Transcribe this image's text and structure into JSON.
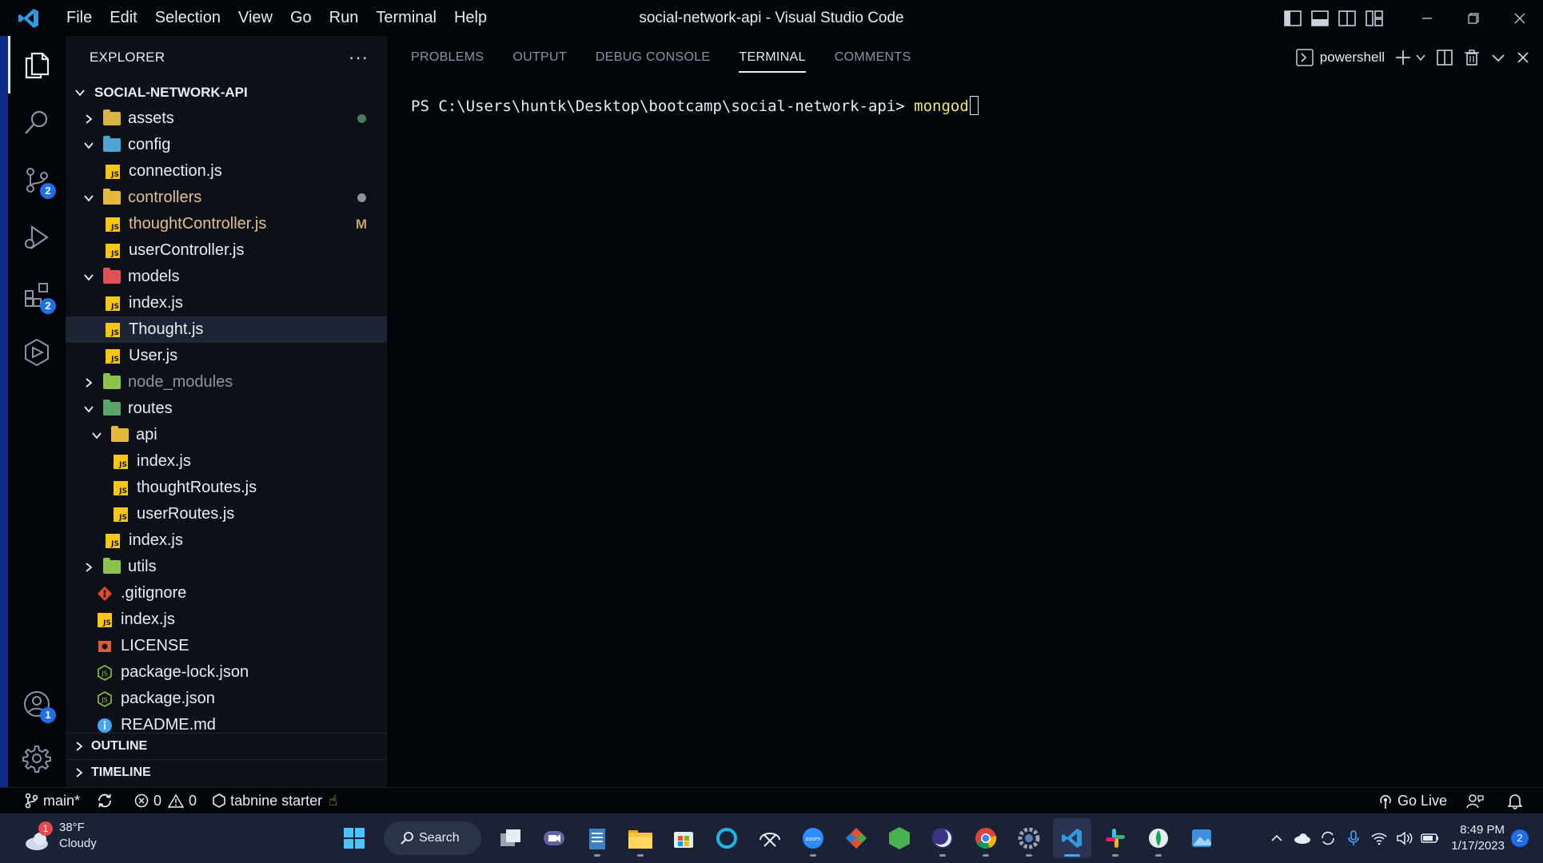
{
  "titlebar": {
    "menu": [
      "File",
      "Edit",
      "Selection",
      "View",
      "Go",
      "Run",
      "Terminal",
      "Help"
    ],
    "title": "social-network-api - Visual Studio Code"
  },
  "activity_bar": {
    "source_control_badge": "2",
    "extensions_badge": "2",
    "accounts_badge": "1"
  },
  "sidebar": {
    "title": "EXPLORER",
    "more": "···",
    "project": "SOCIAL-NETWORK-API",
    "outline": "OUTLINE",
    "timeline": "TIMELINE",
    "tree": [
      {
        "label": "assets",
        "type": "folder",
        "depth": 0,
        "open": false,
        "status": "dot-green",
        "color": "#d9b341"
      },
      {
        "label": "config",
        "type": "folder",
        "depth": 0,
        "open": true,
        "color": "#4fa3d1"
      },
      {
        "label": "connection.js",
        "type": "js",
        "depth": 1
      },
      {
        "label": "controllers",
        "type": "folder",
        "depth": 0,
        "open": true,
        "status": "dot",
        "color": "#e8b93a",
        "name_color": "modified"
      },
      {
        "label": "thoughtController.js",
        "type": "js",
        "depth": 1,
        "status": "M",
        "name_color": "modified"
      },
      {
        "label": "userController.js",
        "type": "js",
        "depth": 1
      },
      {
        "label": "models",
        "type": "folder",
        "depth": 0,
        "open": true,
        "color": "#e05252"
      },
      {
        "label": "index.js",
        "type": "js",
        "depth": 1
      },
      {
        "label": "Thought.js",
        "type": "js",
        "depth": 1,
        "selected": true
      },
      {
        "label": "User.js",
        "type": "js",
        "depth": 1
      },
      {
        "label": "node_modules",
        "type": "folder",
        "depth": 0,
        "open": false,
        "color": "#8bc34a",
        "name_color": "ignored"
      },
      {
        "label": "routes",
        "type": "folder",
        "depth": 0,
        "open": true,
        "color": "#5aa36b"
      },
      {
        "label": "api",
        "type": "folder",
        "depth": 1,
        "open": true,
        "color": "#e8b93a"
      },
      {
        "label": "index.js",
        "type": "js",
        "depth": 2
      },
      {
        "label": "thoughtRoutes.js",
        "type": "js",
        "depth": 2
      },
      {
        "label": "userRoutes.js",
        "type": "js",
        "depth": 2
      },
      {
        "label": "index.js",
        "type": "js",
        "depth": 1
      },
      {
        "label": "utils",
        "type": "folder",
        "depth": 0,
        "open": false,
        "color": "#8bc34a"
      },
      {
        "label": ".gitignore",
        "type": "git",
        "depth": 0
      },
      {
        "label": "index.js",
        "type": "js",
        "depth": 0
      },
      {
        "label": "LICENSE",
        "type": "license",
        "depth": 0
      },
      {
        "label": "package-lock.json",
        "type": "node",
        "depth": 0
      },
      {
        "label": "package.json",
        "type": "node",
        "depth": 0
      },
      {
        "label": "README.md",
        "type": "info",
        "depth": 0
      }
    ]
  },
  "panel": {
    "tabs": [
      "PROBLEMS",
      "OUTPUT",
      "DEBUG CONSOLE",
      "TERMINAL",
      "COMMENTS"
    ],
    "active_tab": "TERMINAL",
    "shell": "powershell",
    "prompt": "PS C:\\Users\\huntk\\Desktop\\bootcamp\\social-network-api> ",
    "command": "mongod"
  },
  "statusbar": {
    "branch": "main*",
    "errors": "0",
    "warnings": "0",
    "tabnine": "tabnine starter",
    "golive": "Go Live"
  },
  "taskbar": {
    "weather_temp": "38°F",
    "weather_desc": "Cloudy",
    "weather_badge": "1",
    "search": "Search",
    "time": "8:49 PM",
    "date": "1/17/2023",
    "notifications": "2"
  },
  "colors": {
    "accent": "#1f6feb",
    "js_icon": "#f5c518",
    "modified": "#e2c08d",
    "terminal_command": "#f0e66c"
  }
}
